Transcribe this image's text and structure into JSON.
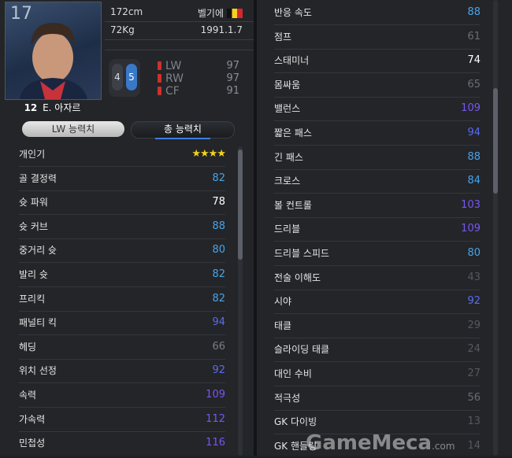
{
  "player": {
    "number": "17",
    "name_badge": "12",
    "name": "E. 아자르",
    "height": "172cm",
    "weight": "72Kg",
    "nationality": "벨기에",
    "birthdate": "1991.1.7",
    "foot_left": "4",
    "foot_right": "5",
    "positions": [
      {
        "pos": "LW",
        "value": "97"
      },
      {
        "pos": "RW",
        "value": "97"
      },
      {
        "pos": "CF",
        "value": "91"
      }
    ]
  },
  "tabs": [
    {
      "label": "LW 능력치",
      "active": false
    },
    {
      "label": "총 능력치",
      "active": true
    }
  ],
  "left_stats": [
    {
      "label": "개인기",
      "value": "★★★★",
      "color": "#f2d21c"
    },
    {
      "label": "골 결정력",
      "value": "82",
      "color": "#4aa3e8"
    },
    {
      "label": "슛 파워",
      "value": "78",
      "color": "#ffffff"
    },
    {
      "label": "슛 커브",
      "value": "88",
      "color": "#4aa3e8"
    },
    {
      "label": "중거리 슛",
      "value": "80",
      "color": "#4aa3e8"
    },
    {
      "label": "발리 슛",
      "value": "82",
      "color": "#4aa3e8"
    },
    {
      "label": "프리킥",
      "value": "82",
      "color": "#4aa3e8"
    },
    {
      "label": "패널티 킥",
      "value": "94",
      "color": "#5a6cf0"
    },
    {
      "label": "헤딩",
      "value": "66",
      "color": "#7a7d82"
    },
    {
      "label": "위치 선정",
      "value": "92",
      "color": "#5a6cf0"
    },
    {
      "label": "속력",
      "value": "109",
      "color": "#7a55f2"
    },
    {
      "label": "가속력",
      "value": "112",
      "color": "#7a55f2"
    },
    {
      "label": "민첩성",
      "value": "116",
      "color": "#7a55f2"
    }
  ],
  "right_stats": [
    {
      "label": "반응 속도",
      "value": "88",
      "color": "#4aa3e8"
    },
    {
      "label": "점프",
      "value": "61",
      "color": "#6a6d72"
    },
    {
      "label": "스태미너",
      "value": "74",
      "color": "#ffffff"
    },
    {
      "label": "몸싸움",
      "value": "65",
      "color": "#6a6d72"
    },
    {
      "label": "밸런스",
      "value": "109",
      "color": "#7a55f2"
    },
    {
      "label": "짧은 패스",
      "value": "94",
      "color": "#5a6cf0"
    },
    {
      "label": "긴 패스",
      "value": "88",
      "color": "#4aa3e8"
    },
    {
      "label": "크로스",
      "value": "84",
      "color": "#4aa3e8"
    },
    {
      "label": "볼 컨트롤",
      "value": "103",
      "color": "#7a55f2"
    },
    {
      "label": "드리블",
      "value": "109",
      "color": "#7a55f2"
    },
    {
      "label": "드리블 스피드",
      "value": "80",
      "color": "#4aa3e8"
    },
    {
      "label": "전술 이해도",
      "value": "43",
      "color": "#55585d"
    },
    {
      "label": "시야",
      "value": "92",
      "color": "#5a6cf0"
    },
    {
      "label": "태클",
      "value": "29",
      "color": "#55585d"
    },
    {
      "label": "슬라이딩 태클",
      "value": "24",
      "color": "#55585d"
    },
    {
      "label": "대인 수비",
      "value": "27",
      "color": "#55585d"
    },
    {
      "label": "적극성",
      "value": "56",
      "color": "#6a6d72"
    },
    {
      "label": "GK 다이빙",
      "value": "13",
      "color": "#55585d"
    },
    {
      "label": "GK 핸들링",
      "value": "14",
      "color": "#55585d"
    }
  ],
  "watermark": {
    "text": "GameMeca",
    "domain": ".com"
  }
}
